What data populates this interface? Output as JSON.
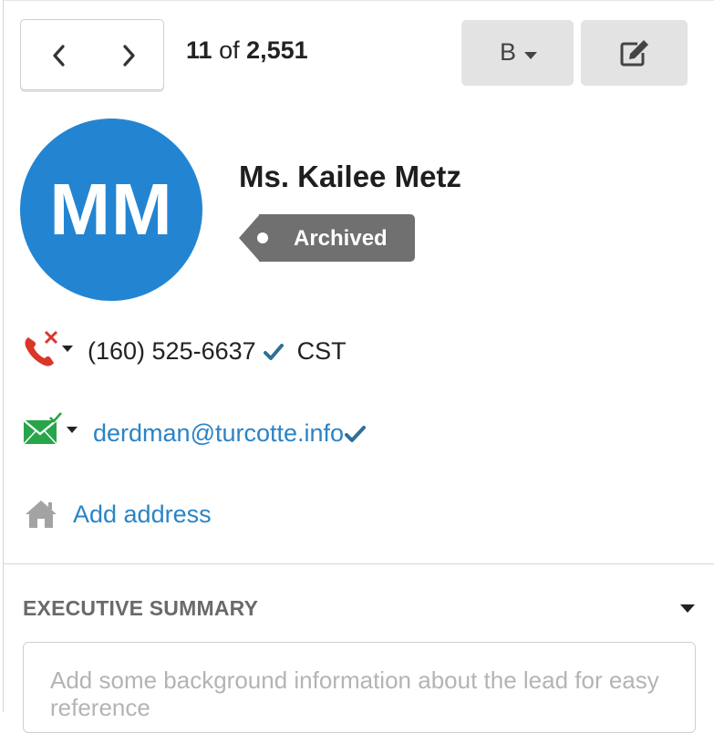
{
  "pager": {
    "current": "11",
    "of_label": "of",
    "total": "2,551"
  },
  "toolbar": {
    "b_label": "B",
    "icons": [
      "chevron-left-icon",
      "chevron-right-icon",
      "caret-down-icon",
      "edit-icon"
    ]
  },
  "contact": {
    "initials": "MM",
    "name": "Ms. Kailee Metz",
    "status": "Archived",
    "phone": "(160) 525-6637",
    "timezone": "CST",
    "email": "derdman@turcotte.info",
    "add_address": "Add address"
  },
  "summary": {
    "title": "EXECUTIVE SUMMARY",
    "placeholder": "Add some background information about the lead for easy reference"
  },
  "colors": {
    "avatar": "#2385d2",
    "tag": "#707070",
    "link": "#2a84c6",
    "phone_icon": "#d9372a",
    "email_icon": "#27a549",
    "verified_check": "#2f6f98"
  }
}
